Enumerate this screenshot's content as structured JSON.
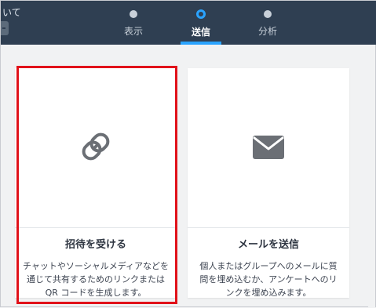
{
  "header": {
    "left_fragment": "いて",
    "steps": [
      {
        "label": "表示",
        "active": false
      },
      {
        "label": "送信",
        "active": true
      },
      {
        "label": "分析",
        "active": false
      }
    ],
    "accent_color": "#2aa3ff",
    "bg_color": "#2f3f52"
  },
  "cards": [
    {
      "title": "招待を受ける",
      "description": "チャットやソーシャルメディアなどを通じて共有するためのリンクまたはQR コードを生成します。",
      "icon": "link-icon",
      "selected": true
    },
    {
      "title": "メールを送信",
      "description": "個人またはグループへのメールに質問を埋め込むか、アンケートへのリンクを埋め込みます。",
      "icon": "mail-icon",
      "selected": false
    }
  ],
  "selection_color": "#e1121a"
}
